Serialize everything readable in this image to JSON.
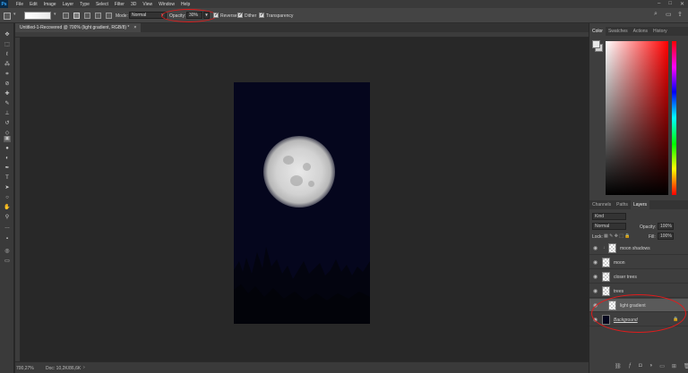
{
  "menu": {
    "items": [
      "File",
      "Edit",
      "Image",
      "Layer",
      "Type",
      "Select",
      "Filter",
      "3D",
      "View",
      "Window",
      "Help"
    ]
  },
  "options": {
    "mode_label": "Mode:",
    "mode_value": "Normal",
    "opacity_label": "Opacity:",
    "opacity_value": "30%",
    "reverse_label": "Reverse",
    "dither_label": "Dither",
    "transparency_label": "Transparency"
  },
  "document": {
    "tab_title": "Untitled-1-Recovered @ 700% (light gradient, RGB/8) *",
    "tab_close": "×"
  },
  "status": {
    "zoom": "700,27%",
    "doc_info": "Doc: 10,2K/86,6K"
  },
  "color_panel": {
    "tabs": [
      "Color",
      "Swatches",
      "Actions",
      "History"
    ]
  },
  "layers_panel": {
    "tabs": [
      "Channels",
      "Paths",
      "Layers"
    ],
    "kind_label": "Kind",
    "blend_mode": "Normal",
    "opacity_label": "Opacity:",
    "opacity_value": "100%",
    "lock_label": "Lock:",
    "fill_label": "Fill:",
    "fill_value": "100%",
    "layers": [
      {
        "name": "moon shadows",
        "selected": false
      },
      {
        "name": "moon",
        "selected": false
      },
      {
        "name": "closer trees",
        "selected": false
      },
      {
        "name": "trees",
        "selected": false
      },
      {
        "name": "light gradient",
        "selected": true
      },
      {
        "name": "Background",
        "selected": false
      }
    ]
  },
  "colors": {
    "canvas_bg": "#05061d",
    "annotation_red": "#e01c1c"
  }
}
